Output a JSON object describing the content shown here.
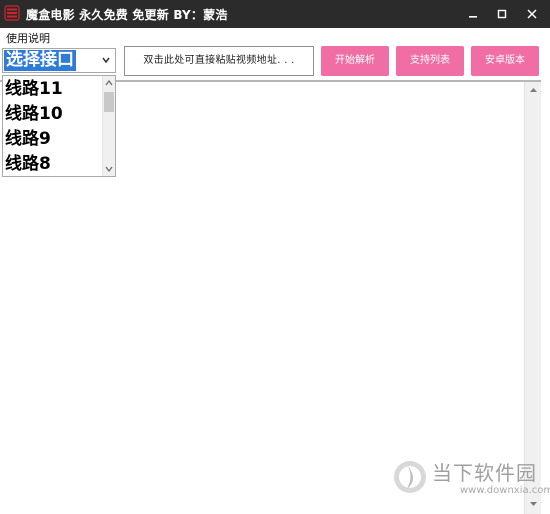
{
  "window": {
    "title": "魔盒电影  永久免费 免更新 BY：蒙浩",
    "controls": {
      "minimize": "minimize",
      "maximize": "maximize",
      "close": "close"
    }
  },
  "menu": {
    "items": [
      {
        "label": "使用说明"
      }
    ]
  },
  "toolbar": {
    "combo_selected": "选择接口",
    "url_placeholder": "双击此处可直接粘贴视频地址. . .",
    "parse_button": "开始解析",
    "support_list_button": "支持列表",
    "android_button": "安卓版本"
  },
  "dropdown": {
    "options": [
      "线路11",
      "线路10",
      "线路9",
      "线路8"
    ]
  },
  "watermark": {
    "name": "当下软件园",
    "url": "www.downxia.com"
  },
  "colors": {
    "titlebar_bg": "#2b2b2b",
    "accent_pink": "#f06ea3",
    "selection_blue": "#2e7bd8",
    "app_icon_red": "#d2232a"
  }
}
